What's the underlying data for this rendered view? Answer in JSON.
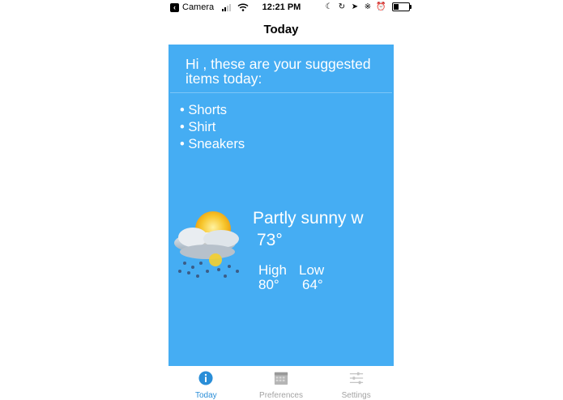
{
  "status_bar": {
    "back_app": "Camera",
    "time": "12:21 PM"
  },
  "nav": {
    "title": "Today"
  },
  "main": {
    "greeting": "Hi , these are your suggested items today:",
    "items": [
      "Shorts",
      "Shirt",
      "Sneakers"
    ],
    "weather": {
      "icon": "partly-sunny-rain-icon",
      "condition": "Partly sunny w",
      "temperature": "73°",
      "high_label": "High",
      "high_value": "80°",
      "low_label": "Low",
      "low_value": "64°"
    }
  },
  "tabs": [
    {
      "label": "Today",
      "icon": "info-icon",
      "active": true
    },
    {
      "label": "Preferences",
      "icon": "calendar-icon",
      "active": false
    },
    {
      "label": "Settings",
      "icon": "sliders-icon",
      "active": false
    }
  ],
  "colors": {
    "panel": "#45adf3",
    "tab_active": "#2a8ed8",
    "tab_inactive": "#a3a3a3"
  }
}
